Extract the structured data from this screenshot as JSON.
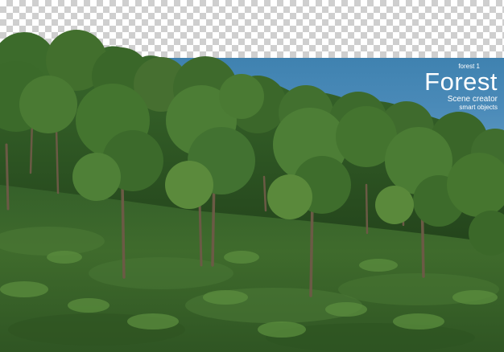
{
  "overlay": {
    "subtitle": "forest 1",
    "title": "Forest",
    "line1": "Scene creator",
    "line2": "smart objects"
  },
  "colors": {
    "sky": "#4a8ab8",
    "checker_dark": "#cfcfcf",
    "checker_light": "#ffffff",
    "foliage_dark": "#2f5a22",
    "foliage_mid": "#3d6e2a",
    "foliage_light": "#5b8a3c",
    "grass": "#3f6b2c",
    "trunk": "#6b5a45",
    "text": "#ffffff"
  },
  "icons": {
    "trees": "tree-canopy",
    "grass": "grass-tufts"
  }
}
